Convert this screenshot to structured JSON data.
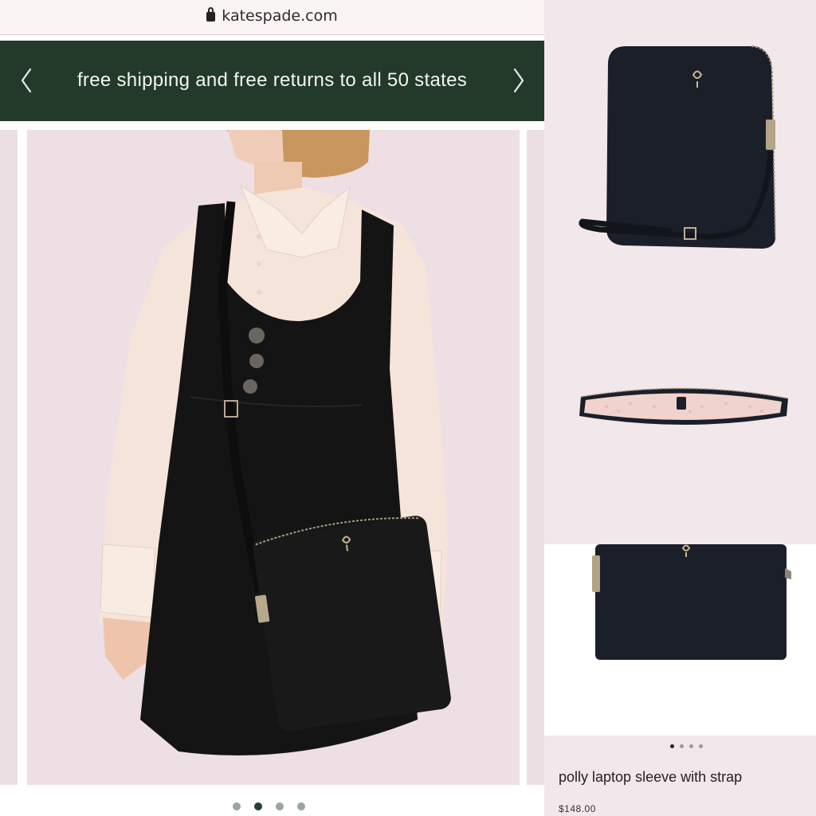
{
  "browser": {
    "url": "katespade.com"
  },
  "promo": {
    "text": "free shipping and free returns to all 50 states"
  },
  "hero_carousel": {
    "slide_count": 4,
    "active_index": 1
  },
  "product": {
    "name": "polly laptop sleeve with strap",
    "price": "$148.00",
    "image_count": 4,
    "active_image": 0
  },
  "colors": {
    "promo_bg": "#233a2b",
    "page_bg": "#f2e7ea",
    "bag": "#1b1f2a"
  }
}
